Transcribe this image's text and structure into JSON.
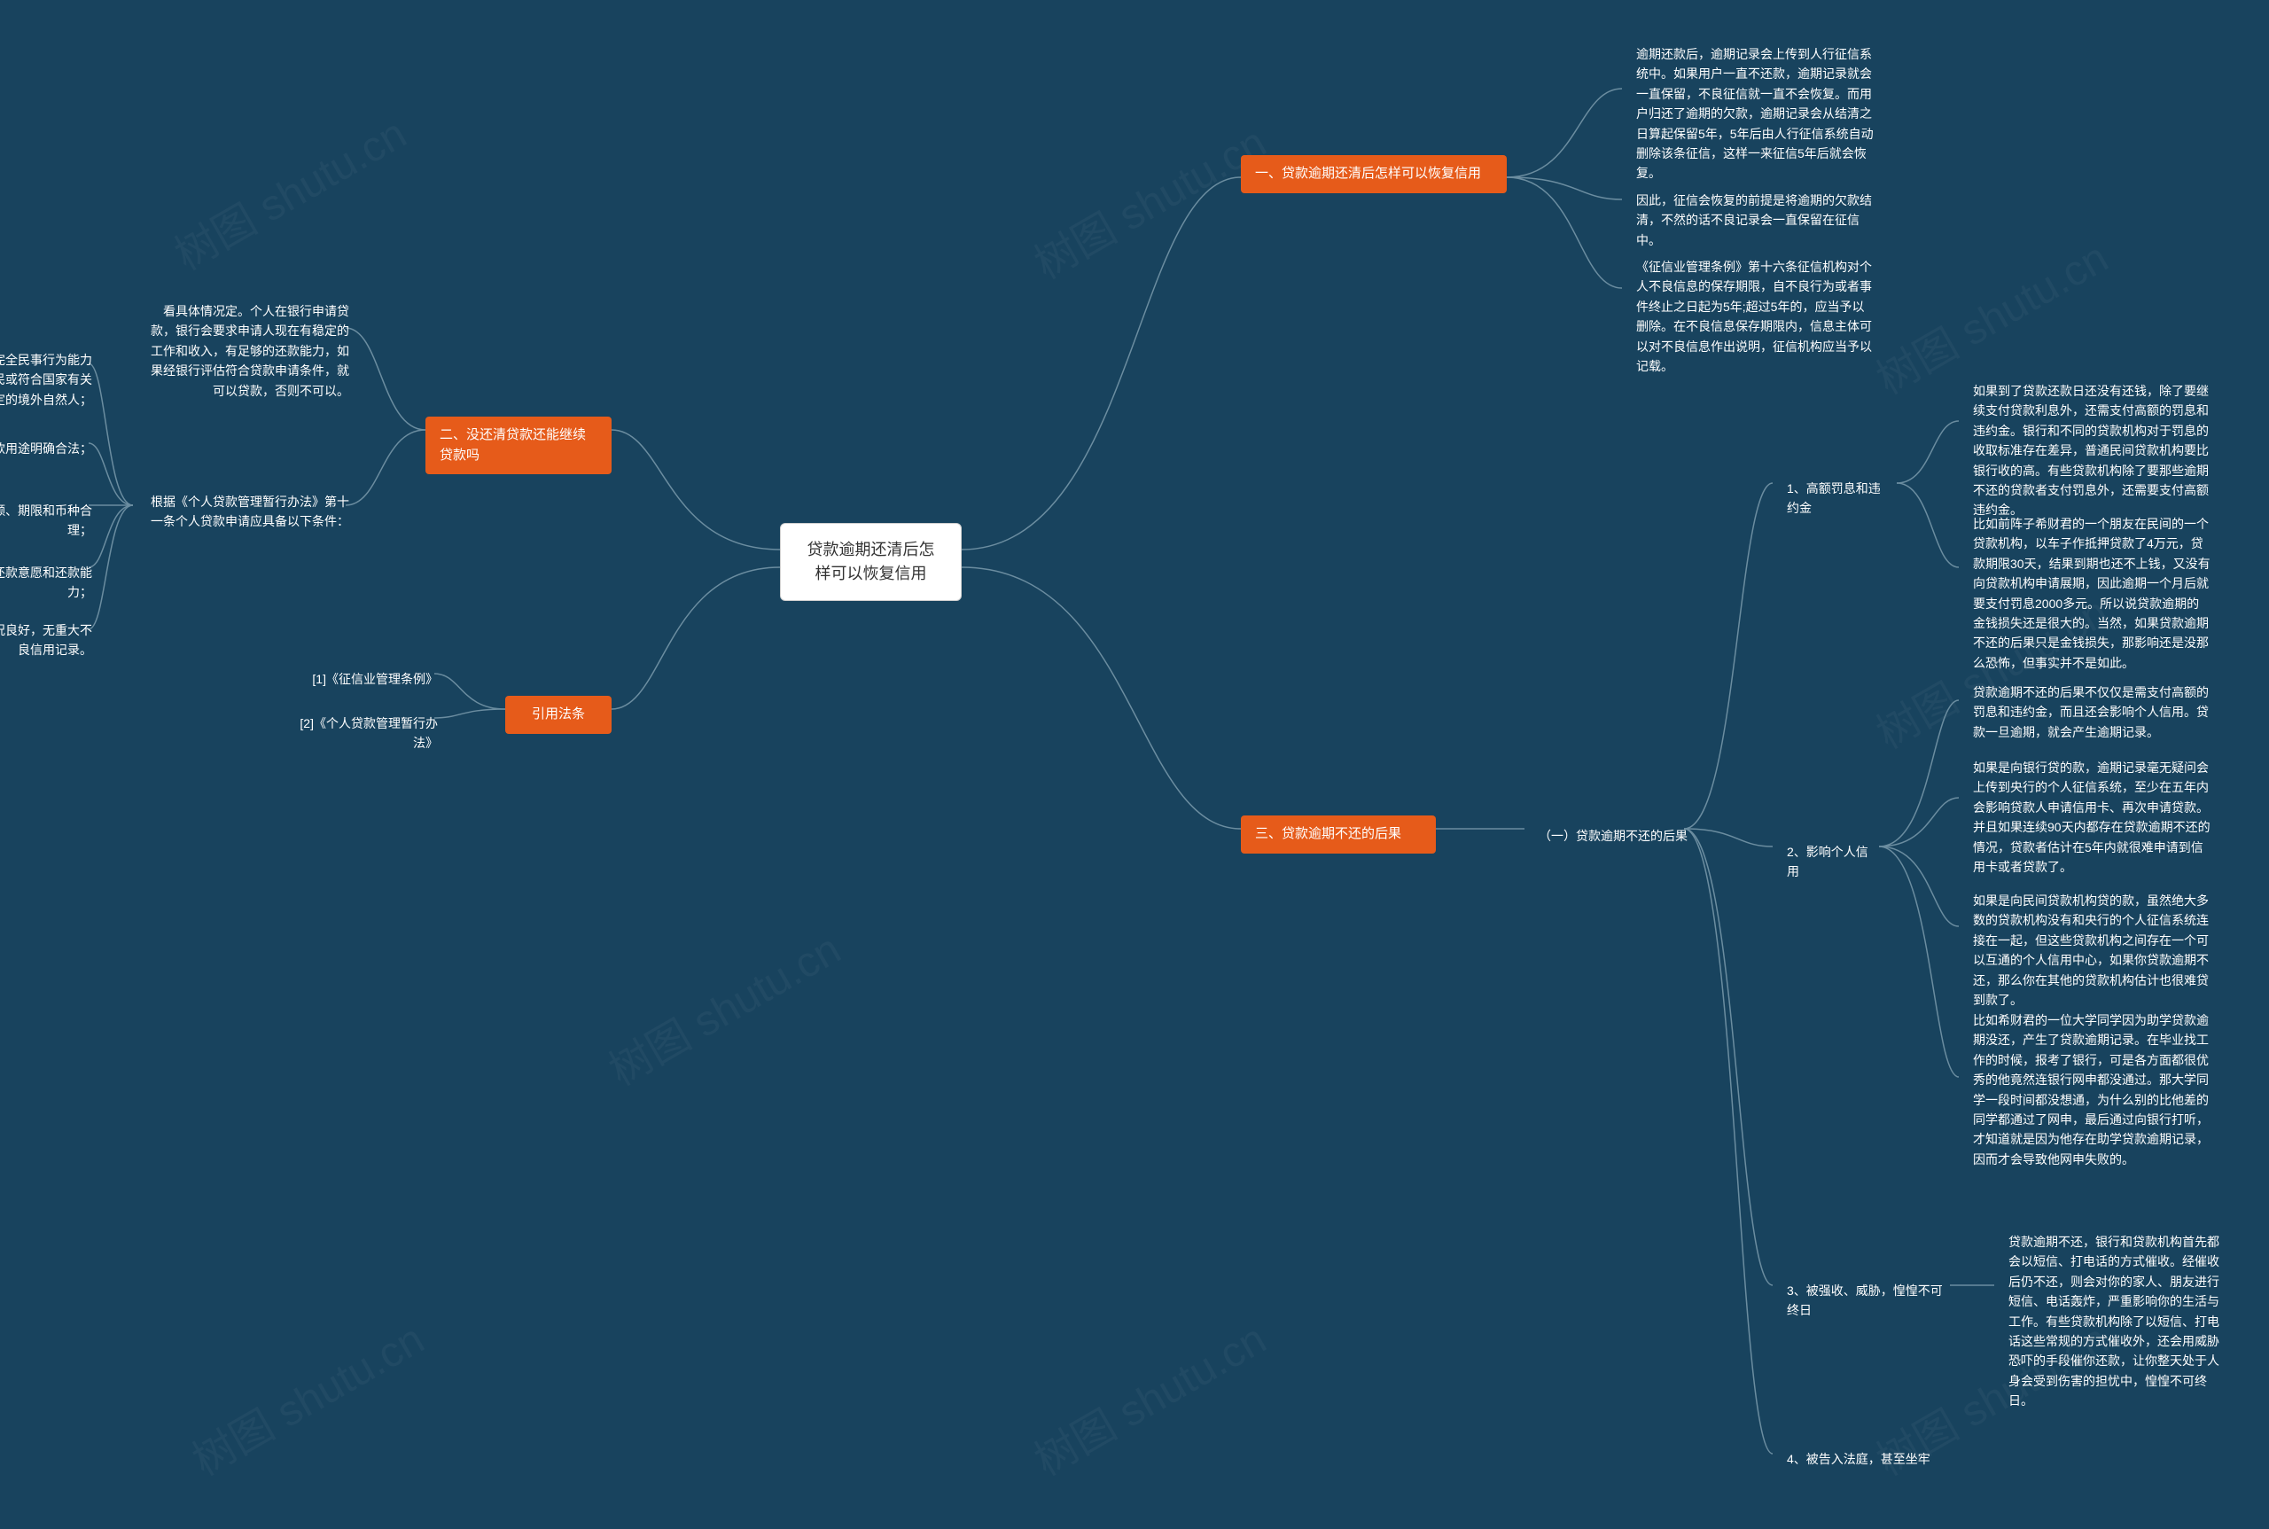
{
  "watermark": "树图 shutu.cn",
  "root": "贷款逾期还清后怎样可以恢复信用",
  "b1": {
    "title": "一、贷款逾期还清后怎样可以恢复信用",
    "c1": "逾期还款后，逾期记录会上传到人行征信系统中。如果用户一直不还款，逾期记录就会一直保留，不良征信就一直不会恢复。而用户归还了逾期的欠款，逾期记录会从结清之日算起保留5年，5年后由人行征信系统自动删除该条征信，这样一来征信5年后就会恢复。",
    "c2": "因此，征信会恢复的前提是将逾期的欠款结清，不然的话不良记录会一直保留在征信中。",
    "c3": "《征信业管理条例》第十六条征信机构对个人不良信息的保存期限，自不良行为或者事件终止之日起为5年;超过5年的，应当予以删除。在不良信息保存期限内，信息主体可以对不良信息作出说明，征信机构应当予以记载。"
  },
  "b2": {
    "title": "二、没还清贷款还能继续贷款吗",
    "c1": "看具体情况定。个人在银行申请贷款，银行会要求申请人现在有稳定的工作和收入，有足够的还款能力，如果经银行评估符合贷款申请条件，就可以贷款，否则不可以。",
    "c2": "根据《个人贷款管理暂行办法》第十一条个人贷款申请应具备以下条件：",
    "sub": [
      "（一）借款人为具有完全民事行为能力的中华人民共和国公民或符合国家有关规定的境外自然人；",
      "（二）贷款用途明确合法；",
      "（三）贷款申请数额、期限和币种合理；",
      "（四）借款人具备还款意愿和还款能力；",
      "（五）借款人信用状况良好，无重大不良信用记录。"
    ]
  },
  "b3": {
    "title": "三、贷款逾期不还的后果",
    "c1": "（一）贷款逾期不还的后果",
    "items": {
      "i1": {
        "label": "1、高额罚息和违约金",
        "p1": "如果到了贷款还款日还没有还钱，除了要继续支付贷款利息外，还需支付高额的罚息和违约金。银行和不同的贷款机构对于罚息的收取标准存在差异，普通民间贷款机构要比银行收的高。有些贷款机构除了要那些逾期不还的贷款者支付罚息外，还需要支付高额违约金。",
        "p2": "比如前阵子希财君的一个朋友在民间的一个贷款机构，以车子作抵押贷款了4万元，贷款期限30天，结果到期也还不上钱，又没有向贷款机构申请展期，因此逾期一个月后就要支付罚息2000多元。所以说贷款逾期的金钱损失还是很大的。当然，如果贷款逾期不还的后果只是金钱损失，那影响还是没那么恐怖，但事实并不是如此。"
      },
      "i2": {
        "label": "2、影响个人信用",
        "p1": "贷款逾期不还的后果不仅仅是需支付高额的罚息和违约金，而且还会影响个人信用。贷款一旦逾期，就会产生逾期记录。",
        "p2": "如果是向银行贷的款，逾期记录毫无疑问会上传到央行的个人征信系统，至少在五年内会影响贷款人申请信用卡、再次申请贷款。并且如果连续90天内都存在贷款逾期不还的情况，贷款者估计在5年内就很难申请到信用卡或者贷款了。",
        "p3": "如果是向民间贷款机构贷的款，虽然绝大多数的贷款机构没有和央行的个人征信系统连接在一起，但这些贷款机构之间存在一个可以互通的个人信用中心，如果你贷款逾期不还，那么你在其他的贷款机构估计也很难贷到款了。",
        "p4": "比如希财君的一位大学同学因为助学贷款逾期没还，产生了贷款逾期记录。在毕业找工作的时候，报考了银行，可是各方面都很优秀的他竟然连银行网申都没通过。那大学同学一段时间都没想通，为什么别的比他差的同学都通过了网申，最后通过向银行打听，才知道就是因为他存在助学贷款逾期记录，因而才会导致他网申失败的。"
      },
      "i3": {
        "label": "3、被强收、威胁，惶惶不可终日",
        "p1": "贷款逾期不还，银行和贷款机构首先都会以短信、打电话的方式催收。经催收后仍不还，则会对你的家人、朋友进行短信、电话轰炸，严重影响你的生活与工作。有些贷款机构除了以短信、打电话这些常规的方式催收外，还会用威胁恐吓的手段催你还款，让你整天处于人身会受到伤害的担忧中，惶惶不可终日。"
      },
      "i4": {
        "label": "4、被告入法庭，甚至坐牢"
      }
    }
  },
  "b4": {
    "title": "引用法条",
    "c1": "[1]《征信业管理条例》",
    "c2": "[2]《个人贷款管理暂行办法》"
  }
}
